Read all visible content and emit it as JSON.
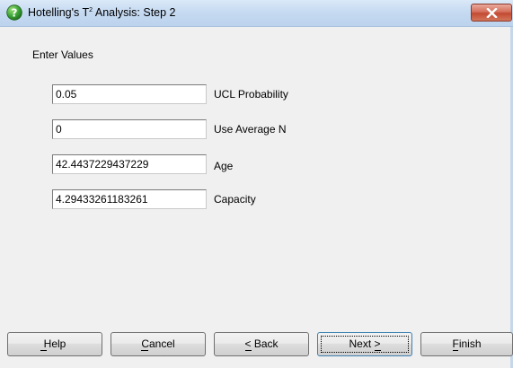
{
  "window": {
    "title_prefix": "Hotelling's T",
    "title_superscript": "2",
    "title_suffix": " Analysis: Step 2"
  },
  "group": {
    "label": "Enter Values"
  },
  "fields": [
    {
      "value": "0.05",
      "label": "UCL Probability"
    },
    {
      "value": "0",
      "label": "Use Average N"
    },
    {
      "value": "42.4437229437229",
      "label": "Age"
    },
    {
      "value": "4.29433261183261",
      "label": "Capacity"
    }
  ],
  "buttons": {
    "help": "Help",
    "cancel": "Cancel",
    "back": "< Back",
    "next": "Next >",
    "finish": "Finish"
  },
  "colors": {
    "titlebar": "#c6daf1",
    "dialog_bg": "#f0f0f0",
    "close_button": "#c24a32",
    "help_icon": "#2e8b2e"
  },
  "icons": {
    "app": "help-question-icon",
    "close": "close-icon"
  }
}
